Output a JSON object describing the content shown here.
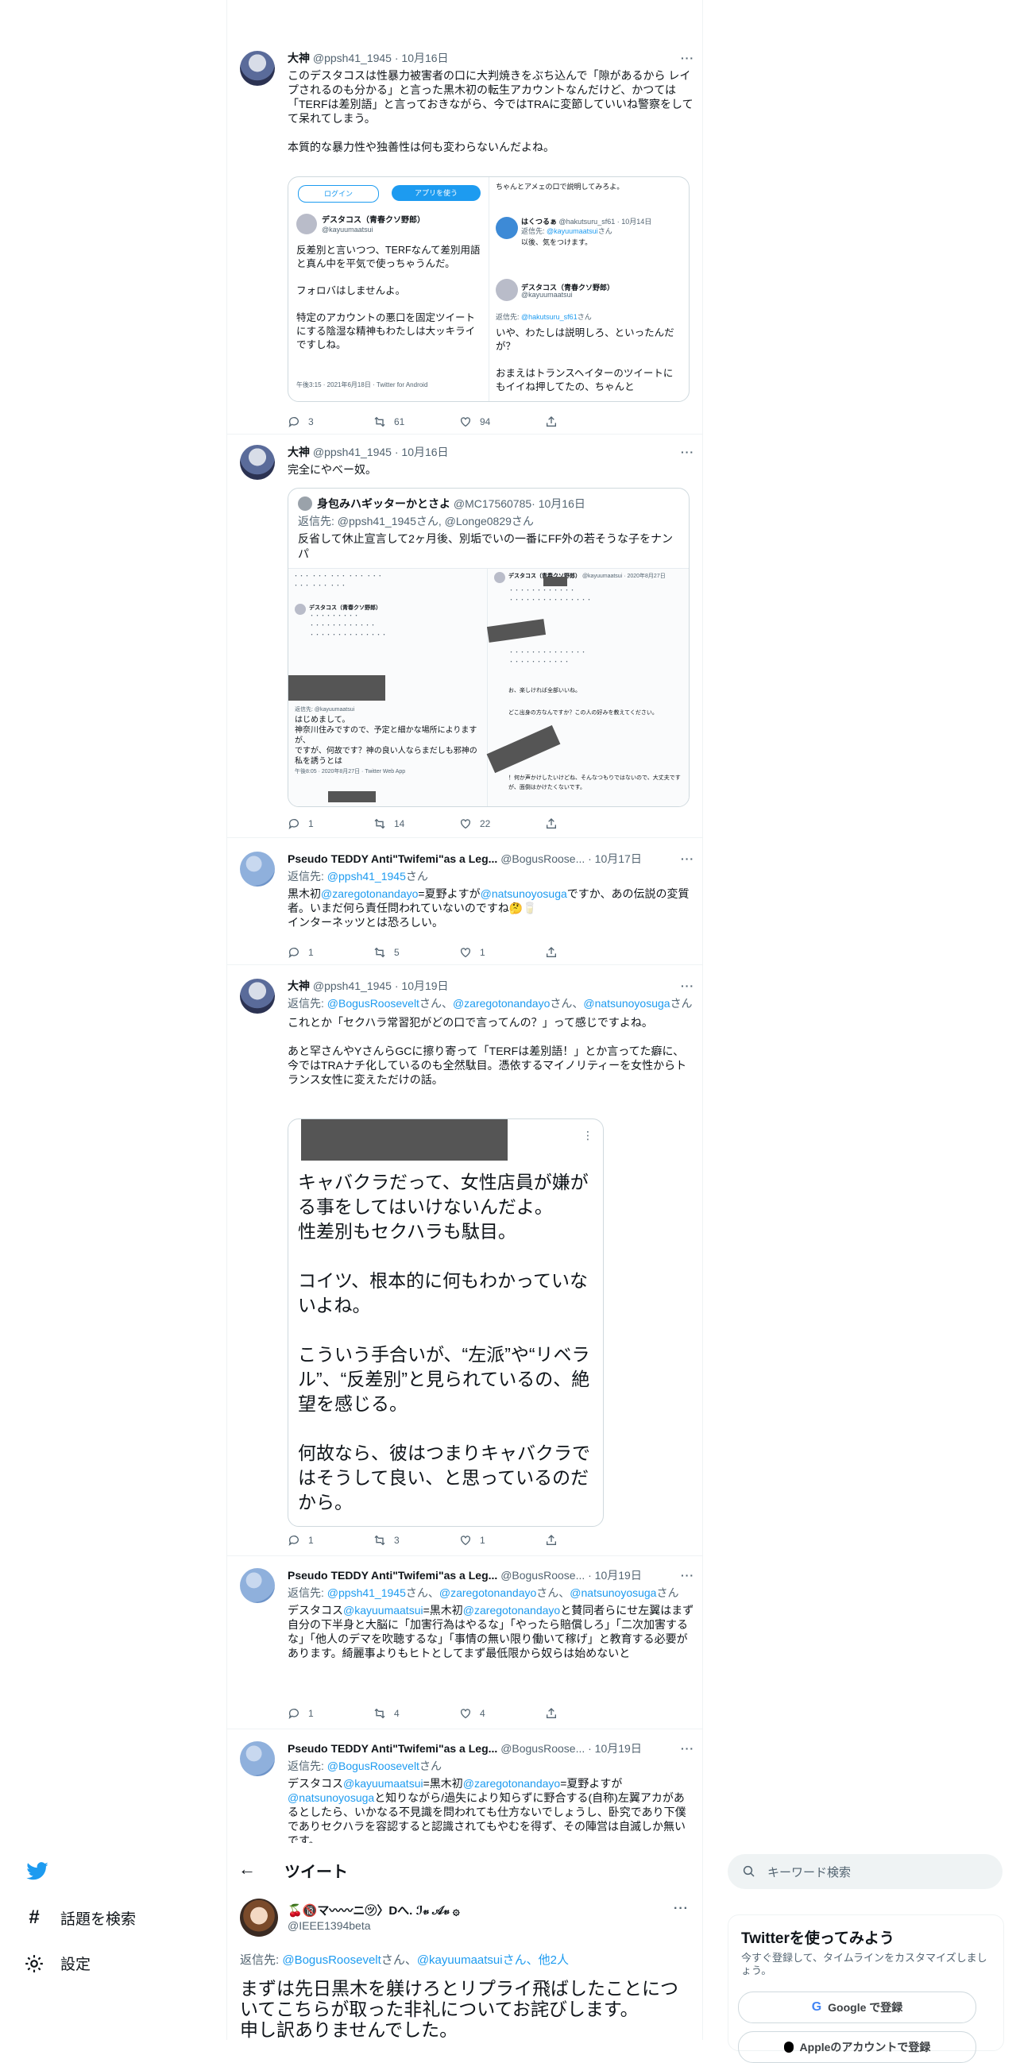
{
  "tweets": [
    {
      "name": "大神",
      "handle": "@ppsh41_1945",
      "date": "· 10月16日",
      "text": "このデスタコスは性暴力被害者の口に大判焼きをぶち込んで「隙があるから レイプされるのも分かる」と言った黒木初の転生アカウントなんだけど、かつては「TERFは差別語」と言っておきながら、今ではTRAに変節していいね警察をしてて呆れてしまう。\n\n本質的な暴力性や独善性は何も変わらないんだよね。",
      "counts": {
        "reply": "3",
        "retweet": "61",
        "like": "94"
      }
    },
    {
      "name": "大神",
      "handle": "@ppsh41_1945",
      "date": "· 10月16日",
      "text": "完全にやべー奴。",
      "counts": {
        "reply": "1",
        "retweet": "14",
        "like": "22"
      }
    },
    {
      "name": "Pseudo TEDDY Anti\"Twifemi\"as a Leg...",
      "handle": "@BogusRoose...",
      "date": "· 10月17日",
      "reply_prefix": "返信先: ",
      "reply_to": "@ppsh41_1945",
      "reply_suffix": "さん",
      "t1": "黒木初",
      "m1": "@zaregotonandayo",
      "t2": "=夏野よすが",
      "m2": "@natsunoyosuga",
      "t3": "ですか、あの伝説の変質者。いまだ何ら責任問われていないのですね🤔🥛\nインターネッツとは恐ろしい。",
      "counts": {
        "reply": "1",
        "retweet": "5",
        "like": "1"
      }
    },
    {
      "name": "大神",
      "handle": "@ppsh41_1945",
      "date": "· 10月19日",
      "reply_prefix": "返信先: ",
      "r1": "@BogusRoosevelt",
      "r2": "@zaregotonandayo",
      "r3": "@natsunoyosuga",
      "san": "さん",
      "sanc": "さん、",
      "text": "これとか「セクハラ常習犯がどの口で言ってんの？」って感じですよね。\n\nあと罕さんやYさんらGCに擦り寄って「TERFは差別語！」とか言ってた癖に、今ではTRAナチ化しているのも全然駄目。憑依するマイノリティーを女性からトランス女性に変えただけの話。",
      "counts": {
        "reply": "1",
        "retweet": "3",
        "like": "1"
      }
    },
    {
      "name": "Pseudo TEDDY Anti\"Twifemi\"as a Leg...",
      "handle": "@BogusRoose...",
      "date": "· 10月19日",
      "reply_prefix": "返信先: ",
      "r1": "@ppsh41_1945",
      "r2": "@zaregotonandayo",
      "r3": "@natsunoyosuga",
      "sanc": "さん、",
      "san_end": "さん",
      "t1": "デスタコス",
      "m1": "@kayuumaatsui",
      "t2": "=黒木初",
      "m2": "@zaregotonandayo",
      "t3": "と賛同者らにせ左翼はまず自分の下半身と大脳に「加害行為はやるな」「やったら賠償しろ」「二次加害するな」「他人のデマを吹聴するな」「事情の無い限り働いて稼げ」と教育する必要があります。綺麗事よりもヒトとしてまず最低限から奴らは始めないと",
      "counts": {
        "reply": "1",
        "retweet": "4",
        "like": "4"
      }
    },
    {
      "name": "Pseudo TEDDY Anti\"Twifemi\"as a Leg...",
      "handle": "@BogusRoose...",
      "date": "· 10月19日",
      "reply_prefix": "返信先: ",
      "r1": "@BogusRoosevelt",
      "san": "さん",
      "t1": "デスタコス",
      "m1": "@kayuumaatsui",
      "t2": "=黒木初",
      "m2": "@zaregotonandayo",
      "t3": "=夏野よすが",
      "m3": "@natsunoyosuga",
      "t4": "と知りながら/過失により知らずに野合する(自称)左翼アカがあるとしたら、いかなる不見識を問われても仕方ないでしょうし、卧究であり下僕でありセクハラを容認すると認識されてもやむを得ず、その陣営は",
      "t5": "自滅しか無いです。"
    }
  ],
  "embed1": {
    "login": "ログイン",
    "app": "アプリを使う",
    "name": "デスタコス（青春クソ野郎）",
    "handle": "@kayuumaatsui",
    "text": "反差別と言いつつ、TERFなんて差別用語と真ん中を平気で使っちゃうんだ。\n\nフォロバはしませんよ。\n\n特定のアカウントの悪口を固定ツイートにする陰湿な精神もわたしは大ッキライですしね。",
    "meta": "午後3:15 · 2021年6月18日 · Twitter for Android",
    "r_top": "ちゃんとアメェの口で説明してみろよ。",
    "r_name1": "はくつるぁ",
    "r_handle1": "@hakutsuru_sf61 · 10月14日",
    "r_reply1_prefix": "返信先: ",
    "r_reply1_to": "@kayuumaatsui",
    "r_reply1_suffix": "さん",
    "r_text1": "以後、気をつけます。",
    "r_name2": "デスタコス（青春クソ野郎）",
    "r_handle2": "@kayuumaatsui",
    "r_reply2_prefix": "返信先: ",
    "r_reply2_to": "@hakutsuru_sf61",
    "r_reply2_suffix": "さん",
    "r_text2": "いや、わたしは説明しろ、といったんだが？\n\nおまえはトランスヘイターのツイートにもイイね押してたの、ちゃんと"
  },
  "quote": {
    "name": "身包みハギッターかとさよ",
    "handle": "@MC17560785",
    "date": "· 10月16日",
    "reply_prefix": "返信先: ",
    "reply_to": "@ppsh41_1945さん, @Longe0829さん",
    "text": "反省して休止宣言して2ヶ月後、別垢でいの一番にFF外の若そうな子をナンパ",
    "inner_left": "はじめまして。\n神奈川住みですので、予定と細かな場所によりますが、\nですが、何故です？神の良い人ならまだしも邪神の私を誘うとは",
    "inner_left_meta": "午後8:05 · 2020年8月27日 · Twitter Web App",
    "inner_name": "デスタコス（青春クソ野郎）",
    "inner_handle": "@kayuumaatsui · 2020年8月27日",
    "inner_reply": "返信先: @kayuumaatsui",
    "inner_right1": "お、楽しければ全部いいね。",
    "inner_right2": "どこ出身の方なんですか？この人の好みを教えてください。",
    "inner_right3": "！何か声かけしたいけどね、そんなつもりではないので、大丈夫ですが、面倒はかけたくないです。"
  },
  "image_text": "キャバクラだって、女性店員が嫌がる事をしてはいけないんだよ。\n性差別もセクハラも駄目。\n\nコイツ、根本的に何もわかっていないよね。\n\nこういう手合いが、“左派”や“リベラル”、“反差別”と見られているの、絶望を感じる。\n\n何故なら、彼はつまりキャバクラではそうして良い、と思っているのだから。",
  "more": "···",
  "bottom": {
    "back": "←",
    "title": "ツイート",
    "explore": "話題を検索",
    "settings": "設定",
    "user_name": "🍒🔞マ〰〰ニ㋡〉Dへ. ℐ𝓋 𝒜𝓋 ۞",
    "user_handle": "@IEEE1394beta",
    "reply_prefix": "返信先: ",
    "r1": "@BogusRoosevelt",
    "r2": "@kayuumaatsui",
    "r_mid": "さん、",
    "r_others": "さん、他2人",
    "main_text": "まずは先日黒木を躾けろとリプライ飛ばしたことについてこちらが取った非礼についてお詫びします。\n申し訳ありませんでした。",
    "search_placeholder": "キーワード検索",
    "panel_title": "Twitterを使ってみよう",
    "panel_sub": "今すぐ登録して、タイムラインをカスタマイズしましょう。",
    "google": "Google で登録",
    "apple": "Appleのアカウントで登録"
  },
  "colors": {
    "accent": "#1d9bf0",
    "text": "#0f1419",
    "muted": "#536471",
    "border": "#cfd9de"
  }
}
